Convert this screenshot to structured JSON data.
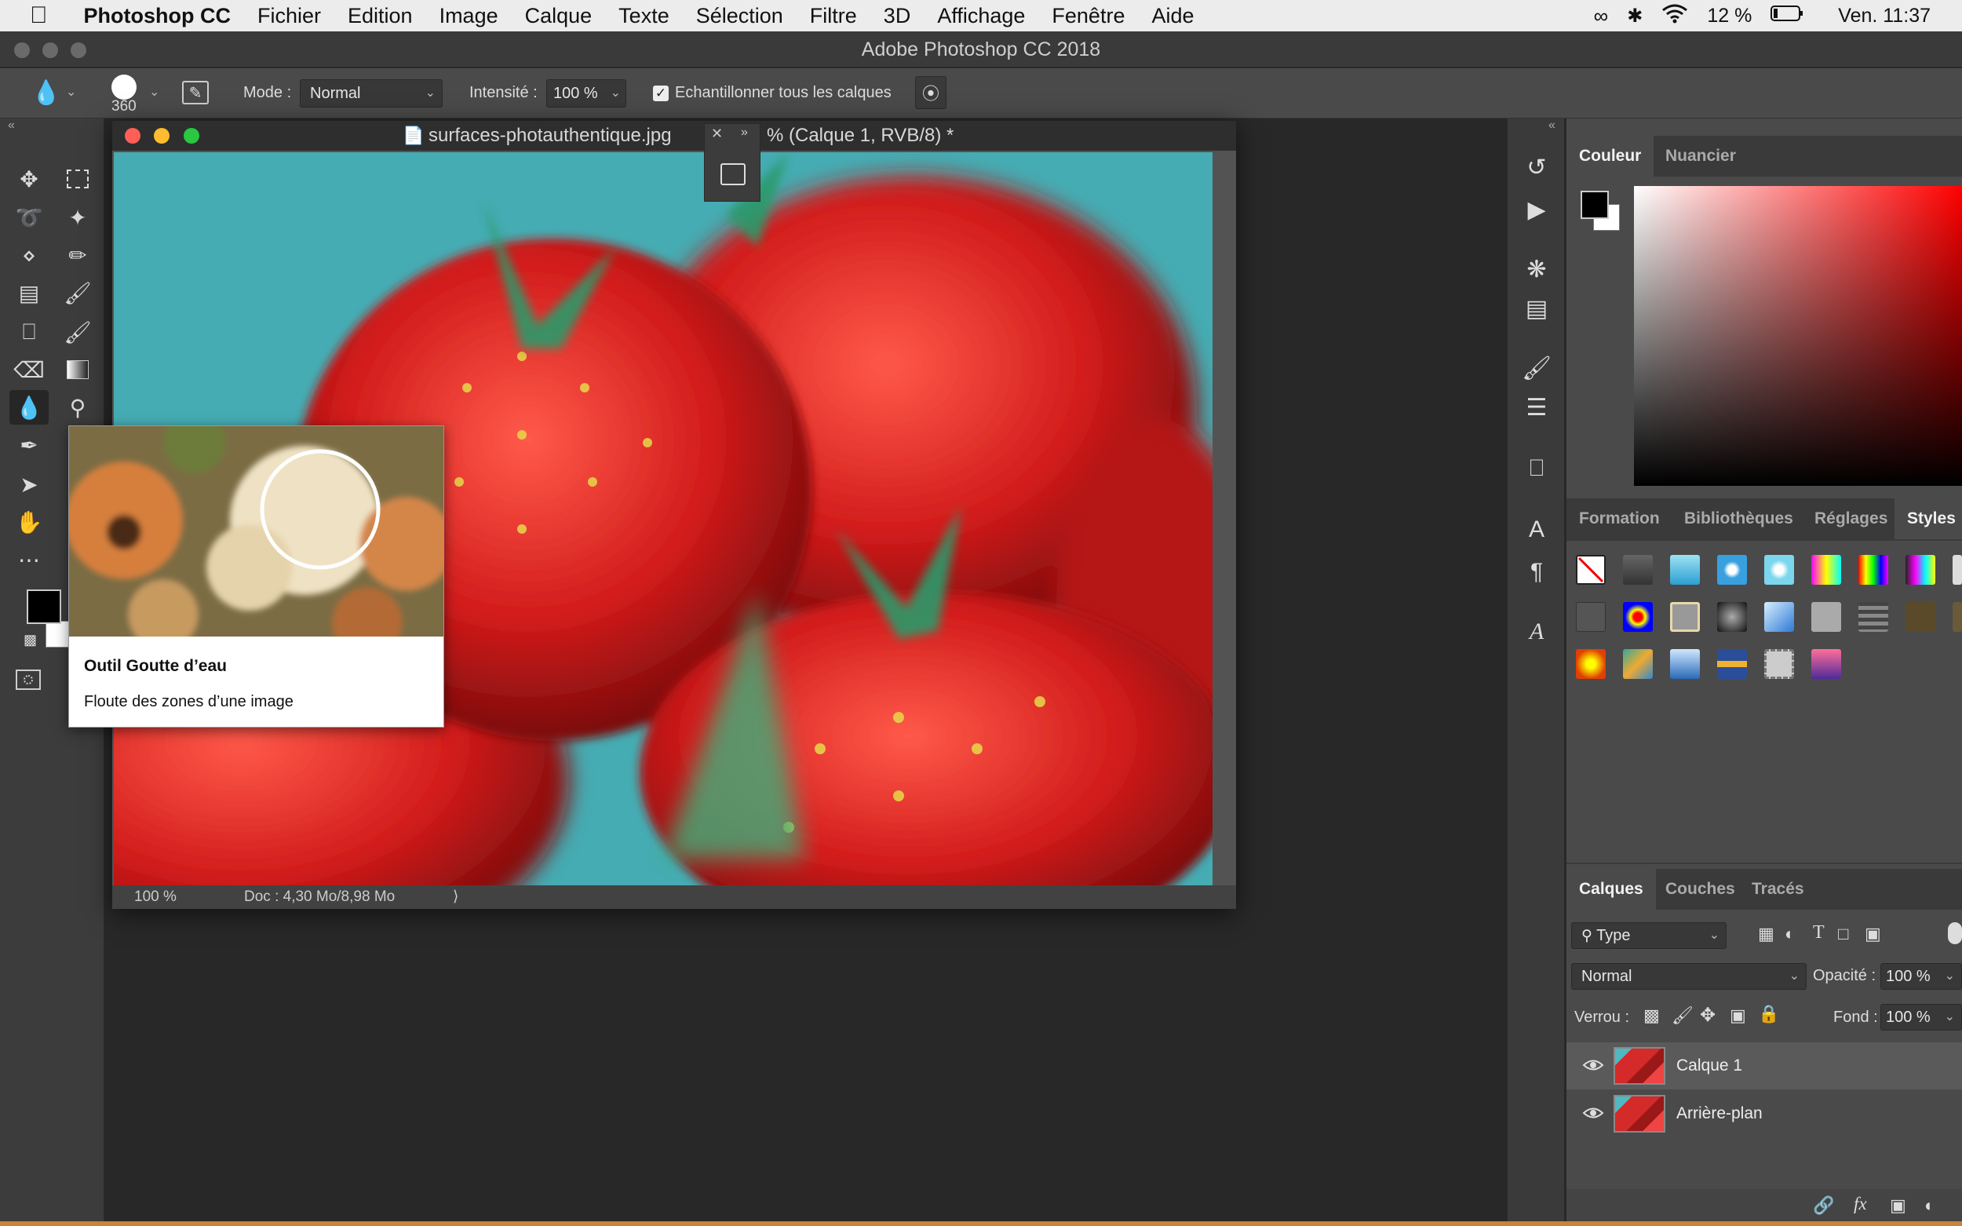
{
  "menubar": {
    "apple_icon": "apple-icon",
    "app_name": "Photoshop CC",
    "items": [
      "Fichier",
      "Edition",
      "Image",
      "Calque",
      "Texte",
      "Sélection",
      "Filtre",
      "3D",
      "Affichage",
      "Fenêtre",
      "Aide"
    ],
    "battery": "12 %",
    "clock": "Ven. 11:37"
  },
  "window": {
    "title": "Adobe Photoshop CC 2018"
  },
  "options": {
    "brush_size": "360",
    "mode_label": "Mode :",
    "mode_value": "Normal",
    "intensity_label": "Intensité :",
    "intensity_value": "100 %",
    "sample_all_checked": true,
    "sample_all_label": "Echantillonner tous les calques"
  },
  "document": {
    "title_left": "surfaces-photauthentique.jpg",
    "title_right": "% (Calque 1, RVB/8) *",
    "zoom": "100 %",
    "doc_info": "Doc : 4,30 Mo/8,98 Mo"
  },
  "tooltip": {
    "title": "Outil Goutte d’eau",
    "description": "Floute des zones d’une image"
  },
  "color_panel": {
    "tabs": [
      "Couleur",
      "Nuancier"
    ],
    "foreground": "#000000",
    "background": "#ffffff"
  },
  "styles_panel": {
    "tabs": [
      "Formation",
      "Bibliothèques",
      "Réglages",
      "Styles"
    ]
  },
  "layers_panel": {
    "tabs": [
      "Calques",
      "Couches",
      "Tracés"
    ],
    "filter_label": "Type",
    "blend_mode": "Normal",
    "opacity_label": "Opacité :",
    "opacity_value": "100 %",
    "lock_label": "Verrou :",
    "fill_label": "Fond :",
    "fill_value": "100 %",
    "layers": [
      {
        "name": "Calque 1",
        "visible": true,
        "selected": true
      },
      {
        "name": "Arrière-plan",
        "visible": true,
        "selected": false
      }
    ]
  }
}
